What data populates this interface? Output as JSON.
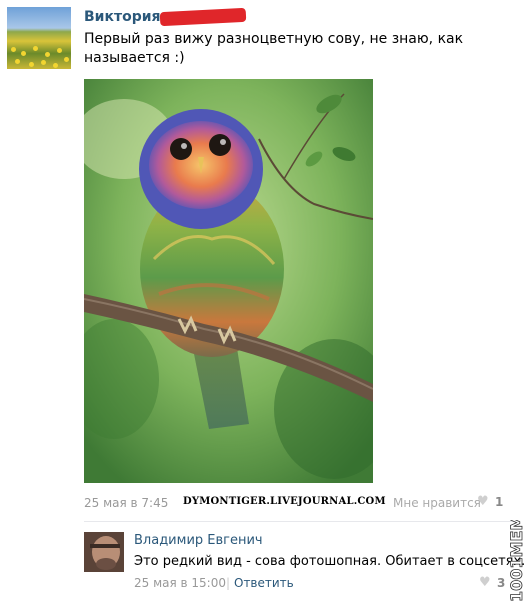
{
  "post": {
    "author": "Виктория",
    "text": "Первый раз вижу разноцветную сову, не знаю, как называется :)",
    "date": "25 мая в 7:45",
    "like_label": "Мне нравится",
    "like_count": "1",
    "watermark": "DYMONTIGER.LIVEJOURNAL.COM"
  },
  "comment": {
    "author": "Владимир Евгенич",
    "text": "Это редкий вид - сова фотошопная. Обитает в соцсетях.",
    "date": "25 мая в 15:00",
    "separator": "|",
    "reply_label": "Ответить",
    "like_count": "3"
  },
  "side_watermark": "1001MEM",
  "colors": {
    "link": "#2b587a",
    "meta": "#999999",
    "redaction": "#e0262a"
  },
  "icons": {
    "heart": "heart-icon"
  }
}
